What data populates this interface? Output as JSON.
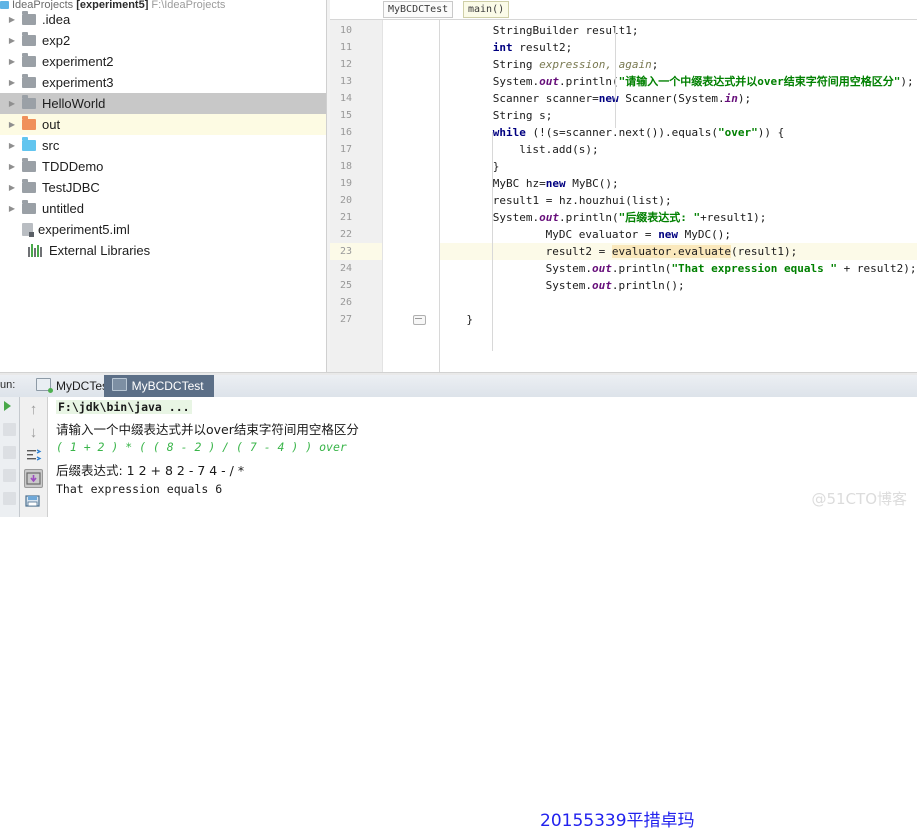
{
  "project": {
    "header": {
      "icon": "module-icon",
      "prefix": "IdeaProjects",
      "name": "[experiment5]",
      "path": "F:\\IdeaProjects"
    },
    "tree": [
      {
        "label": ".idea",
        "icon": "folder-gray",
        "arrow": true,
        "state": "normal"
      },
      {
        "label": "exp2",
        "icon": "folder-gray",
        "arrow": true,
        "state": "normal"
      },
      {
        "label": "experiment2",
        "icon": "folder-gray",
        "arrow": true,
        "state": "normal"
      },
      {
        "label": "experiment3",
        "icon": "folder-gray",
        "arrow": true,
        "state": "normal"
      },
      {
        "label": "HelloWorld",
        "icon": "folder-gray",
        "arrow": true,
        "state": "selected"
      },
      {
        "label": "out",
        "icon": "folder-orange",
        "arrow": true,
        "state": "highlighted"
      },
      {
        "label": "src",
        "icon": "folder-blue",
        "arrow": true,
        "state": "normal"
      },
      {
        "label": "TDDDemo",
        "icon": "folder-gray",
        "arrow": true,
        "state": "normal"
      },
      {
        "label": "TestJDBC",
        "icon": "folder-gray",
        "arrow": true,
        "state": "normal"
      },
      {
        "label": "untitled",
        "icon": "folder-gray",
        "arrow": true,
        "state": "normal"
      },
      {
        "label": "experiment5.iml",
        "icon": "iml-file-icon",
        "arrow": false,
        "state": "normal"
      },
      {
        "label": "External Libraries",
        "icon": "libraries-icon",
        "arrow": false,
        "state": "normal"
      }
    ]
  },
  "editor": {
    "breadcrumb": {
      "class_name": "MyBCDCTest",
      "method_name": "main()"
    },
    "highlighted_line": 23,
    "lines": [
      {
        "n": 10,
        "indent": 8,
        "tokens": [
          {
            "t": "StringBuilder result1;",
            "c": "plain"
          }
        ]
      },
      {
        "n": 11,
        "indent": 8,
        "tokens": [
          {
            "t": "int",
            "c": "kw"
          },
          {
            "t": " result2;",
            "c": "plain"
          }
        ]
      },
      {
        "n": 12,
        "indent": 8,
        "tokens": [
          {
            "t": "String ",
            "c": "plain"
          },
          {
            "t": "expression, again",
            "c": "param"
          },
          {
            "t": ";",
            "c": "plain"
          }
        ]
      },
      {
        "n": 13,
        "indent": 8,
        "tokens": [
          {
            "t": "System.",
            "c": "plain"
          },
          {
            "t": "out",
            "c": "fld"
          },
          {
            "t": ".println(",
            "c": "plain"
          },
          {
            "t": "\"请输入一个中缀表达式并以over结束字符间用空格区分\"",
            "c": "str"
          },
          {
            "t": ");",
            "c": "plain"
          }
        ]
      },
      {
        "n": 14,
        "indent": 8,
        "tokens": [
          {
            "t": "Scanner scanner=",
            "c": "plain"
          },
          {
            "t": "new",
            "c": "kw"
          },
          {
            "t": " Scanner(System.",
            "c": "plain"
          },
          {
            "t": "in",
            "c": "fld"
          },
          {
            "t": ");",
            "c": "plain"
          }
        ]
      },
      {
        "n": 15,
        "indent": 8,
        "tokens": [
          {
            "t": "String s;",
            "c": "plain"
          }
        ]
      },
      {
        "n": 16,
        "indent": 8,
        "tokens": [
          {
            "t": "while",
            "c": "kw"
          },
          {
            "t": " (!(s=scanner.next()).equals(",
            "c": "plain"
          },
          {
            "t": "\"over\"",
            "c": "str"
          },
          {
            "t": ")) {",
            "c": "plain"
          }
        ]
      },
      {
        "n": 17,
        "indent": 12,
        "tokens": [
          {
            "t": "list.add(s);",
            "c": "plain"
          }
        ]
      },
      {
        "n": 18,
        "indent": 8,
        "tokens": [
          {
            "t": "}",
            "c": "plain"
          }
        ]
      },
      {
        "n": 19,
        "indent": 8,
        "tokens": [
          {
            "t": "MyBC hz=",
            "c": "plain"
          },
          {
            "t": "new",
            "c": "kw"
          },
          {
            "t": " MyBC();",
            "c": "plain"
          }
        ]
      },
      {
        "n": 20,
        "indent": 8,
        "tokens": [
          {
            "t": "result1 = hz.houzhui(list);",
            "c": "plain"
          }
        ]
      },
      {
        "n": 21,
        "indent": 8,
        "tokens": [
          {
            "t": "System.",
            "c": "plain"
          },
          {
            "t": "out",
            "c": "fld"
          },
          {
            "t": ".println(",
            "c": "plain"
          },
          {
            "t": "\"后缀表达式:  \"",
            "c": "str"
          },
          {
            "t": "+result1);",
            "c": "plain"
          }
        ]
      },
      {
        "n": 22,
        "indent": 16,
        "tokens": [
          {
            "t": "MyDC evaluator = ",
            "c": "plain"
          },
          {
            "t": "new",
            "c": "kw"
          },
          {
            "t": " MyDC();",
            "c": "plain"
          }
        ]
      },
      {
        "n": 23,
        "indent": 16,
        "tokens": [
          {
            "t": "result2 = ",
            "c": "plain"
          },
          {
            "t": "evaluator.evaluate",
            "c": "pill"
          },
          {
            "t": "(result1);",
            "c": "plain"
          }
        ]
      },
      {
        "n": 24,
        "indent": 16,
        "tokens": [
          {
            "t": "System.",
            "c": "plain"
          },
          {
            "t": "out",
            "c": "fld"
          },
          {
            "t": ".println(",
            "c": "plain"
          },
          {
            "t": "\"That expression equals \"",
            "c": "str"
          },
          {
            "t": " + result2);",
            "c": "plain"
          }
        ]
      },
      {
        "n": 25,
        "indent": 16,
        "tokens": [
          {
            "t": "System.",
            "c": "plain"
          },
          {
            "t": "out",
            "c": "fld"
          },
          {
            "t": ".println();",
            "c": "plain"
          }
        ]
      },
      {
        "n": 26,
        "indent": 0,
        "tokens": []
      },
      {
        "n": 27,
        "indent": 4,
        "tokens": [
          {
            "t": "}",
            "c": "plain"
          }
        ]
      }
    ]
  },
  "run_panel": {
    "label": "un:",
    "tabs": [
      {
        "name": "MyDCTest",
        "active": false
      },
      {
        "name": "MyBCDCTest",
        "active": true
      }
    ],
    "toolbar_icons": [
      "arrow-up-icon",
      "arrow-down-icon",
      "soft-wrap-icon",
      "scroll-to-end-icon",
      "save-icon"
    ],
    "console": [
      {
        "text": "F:\\jdk\\bin\\java ...",
        "style": "cmd"
      },
      {
        "text": "请输入一个中缀表达式并以over结束字符间用空格区分",
        "style": "cjk"
      },
      {
        "text": "( 1 + 2 ) * ( ( 8 - 2 ) / ( 7 - 4 ) ) over",
        "style": "green"
      },
      {
        "text": "后缀表达式:  1 2 + 8 2 - 7 4 - / *",
        "style": "cjk"
      },
      {
        "text": "That expression equals 6",
        "style": "dark"
      }
    ],
    "annotation": "20155339平措卓玛"
  },
  "watermark": "@51CTO博客",
  "colors": {
    "accent_blue": "#2222ee",
    "string_green": "#008000",
    "keyword_navy": "#000080",
    "field_purple": "#660e7a",
    "highlight_yellow": "#fcfae8",
    "tab_active": "#5c6f87"
  }
}
